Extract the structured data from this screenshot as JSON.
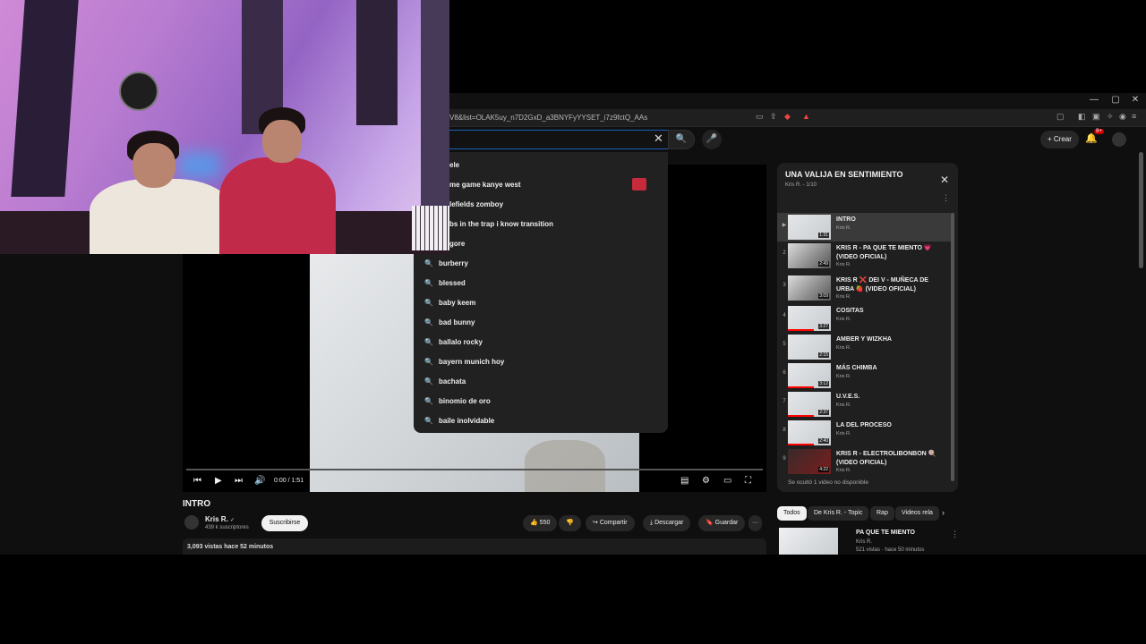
{
  "browser": {
    "url": "V8&list=OLAK5uy_n7D2GxD_a3BNYFyYYSET_i7z9fctQ_AAs",
    "window_controls": [
      "—",
      "▢",
      "✕"
    ]
  },
  "header": {
    "search_value": "",
    "clear_icon": "✕",
    "create_label": "Crear",
    "notification_badge": "9+"
  },
  "search_suggestions": [
    {
      "text": "ele",
      "has_thumb": false
    },
    {
      "text": "me game kanye west",
      "has_thumb": true
    },
    {
      "text": "lefields zomboy",
      "has_thumb": false
    },
    {
      "text": "bs in the trap i know transition",
      "has_thumb": false
    },
    {
      "text": "gore",
      "has_thumb": false
    },
    {
      "text": "burberry",
      "has_thumb": false
    },
    {
      "text": "blessed",
      "has_thumb": false
    },
    {
      "text": "baby keem",
      "has_thumb": false
    },
    {
      "text": "bad bunny",
      "has_thumb": false
    },
    {
      "text": "ballalo rocky",
      "has_thumb": false
    },
    {
      "text": "bayern munich hoy",
      "has_thumb": false
    },
    {
      "text": "bachata",
      "has_thumb": false
    },
    {
      "text": "binomio de oro",
      "has_thumb": false
    },
    {
      "text": "baile inolvidable",
      "has_thumb": false
    }
  ],
  "player": {
    "time": "0:00 / 1:51"
  },
  "video": {
    "title": "INTRO",
    "channel": "Kris R.",
    "verified": "✓",
    "subscribers": "439 k suscriptores",
    "subscribe_label": "Suscribirse",
    "likes": "550",
    "share_label": "Compartir",
    "download_label": "Descargar",
    "save_label": "Guardar",
    "more_label": "···",
    "stats": "3,093 vistas  hace 52 minutos"
  },
  "playlist": {
    "title": "UNA VALIJA EN SENTIMIENTO",
    "subtitle": "Kris R. - 1/10",
    "hidden_note": "Se ocultó 1 video no disponible",
    "items": [
      {
        "num": "▶",
        "name": "INTRO",
        "author": "Kris R.",
        "duration": "1:31",
        "active": true,
        "thumb": "light",
        "progress": 0
      },
      {
        "num": "2",
        "name": "KRIS R - PA QUE TE MIENTO 💗 (VIDEO OFICIAL)",
        "author": "Kris R.",
        "duration": "2:49",
        "active": false,
        "thumb": "mixed",
        "progress": 0
      },
      {
        "num": "3",
        "name": "KRIS R ❌ DEI V - MUÑECA DE URBA 🍓 (VIDEO OFICIAL)",
        "author": "Kris R.",
        "duration": "3:09",
        "active": false,
        "thumb": "mixed",
        "progress": 0
      },
      {
        "num": "4",
        "name": "COSITAS",
        "author": "Kris R.",
        "duration": "3:27",
        "active": false,
        "thumb": "light",
        "progress": 0.6
      },
      {
        "num": "5",
        "name": "AMBER Y WIZKHA",
        "author": "Kris R.",
        "duration": "2:15",
        "active": false,
        "thumb": "light",
        "progress": 0
      },
      {
        "num": "6",
        "name": "MÁS CHIMBA",
        "author": "Kris R.",
        "duration": "3:12",
        "active": false,
        "thumb": "light",
        "progress": 0.6
      },
      {
        "num": "7",
        "name": "U.V.E.S.",
        "author": "Kris R.",
        "duration": "2:37",
        "active": false,
        "thumb": "light",
        "progress": 0.6
      },
      {
        "num": "8",
        "name": "LA DEL PROCESO",
        "author": "Kris R.",
        "duration": "2:40",
        "active": false,
        "thumb": "light",
        "progress": 0.6
      },
      {
        "num": "9",
        "name": "KRIS R - ELECTROLIBONBON 🍭 (VIDEO OFICIAL)",
        "author": "Kris R.",
        "duration": "4:22",
        "active": false,
        "thumb": "dark",
        "progress": 0
      }
    ]
  },
  "chips": [
    "Todos",
    "De Kris R. - Topic",
    "Rap",
    "Videos rela"
  ],
  "recommendation": {
    "title": "PA QUE TE MIENTO",
    "author": "Kris R.",
    "meta": "521 vistas · hace 50 minutos"
  },
  "colors": {
    "accent": "#ff0000",
    "search_border": "#1c62b9"
  },
  "icons": {
    "search": "🔍",
    "mic": "🎤",
    "prev": "⏮",
    "play": "▶",
    "next": "⏭",
    "volume": "🔊",
    "settings": "⚙",
    "theater": "▭",
    "fullscreen": "⛶",
    "close": "✕",
    "chevron_right": "›",
    "like": "👍",
    "dislike": "👎",
    "share": "↪",
    "download": "⤓",
    "save": "🔖",
    "bell": "🔔",
    "plus": "+"
  }
}
